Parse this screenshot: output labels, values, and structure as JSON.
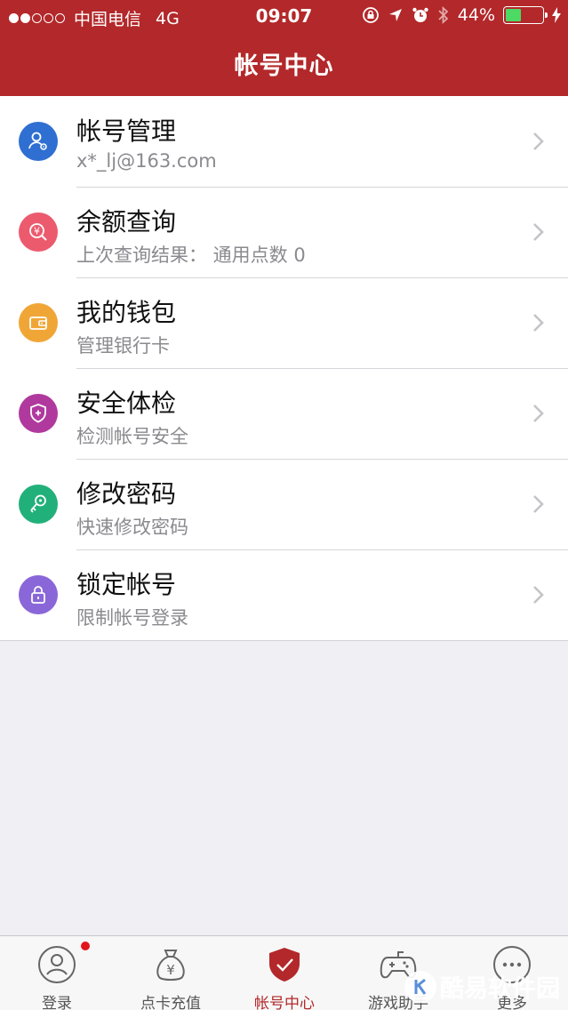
{
  "status_bar": {
    "carrier": "中国电信",
    "network": "4G",
    "time": "09:07",
    "battery": "44%",
    "battery_level": 0.44
  },
  "nav": {
    "title": "帐号中心"
  },
  "menu": [
    {
      "title": "帐号管理",
      "subtitle": "x*_lj@163.com",
      "icon": "user-gear-icon",
      "color": "#2f6fd2"
    },
    {
      "title": "余额查询",
      "subtitle": "上次查询结果：  通用点数 0",
      "icon": "yen-search-icon",
      "color": "#ec5a6e"
    },
    {
      "title": "我的钱包",
      "subtitle": "管理银行卡",
      "icon": "wallet-icon",
      "color": "#f0a637"
    },
    {
      "title": "安全体检",
      "subtitle": "检测帐号安全",
      "icon": "shield-plus-icon",
      "color": "#b0399e"
    },
    {
      "title": "修改密码",
      "subtitle": "快速修改密码",
      "icon": "key-icon",
      "color": "#22b07a"
    },
    {
      "title": "锁定帐号",
      "subtitle": "限制帐号登录",
      "icon": "lock-icon",
      "color": "#8a67d8"
    }
  ],
  "tabbar": {
    "items": [
      {
        "label": "登录",
        "icon": "person-icon"
      },
      {
        "label": "点卡充值",
        "icon": "money-bag-icon"
      },
      {
        "label": "帐号中心",
        "icon": "shield-check-icon",
        "active": true
      },
      {
        "label": "游戏助手",
        "icon": "gamepad-icon"
      },
      {
        "label": "更多",
        "icon": "more-icon"
      }
    ],
    "active_color": "#b3282a"
  },
  "watermark": {
    "text": "酷易软件园"
  }
}
